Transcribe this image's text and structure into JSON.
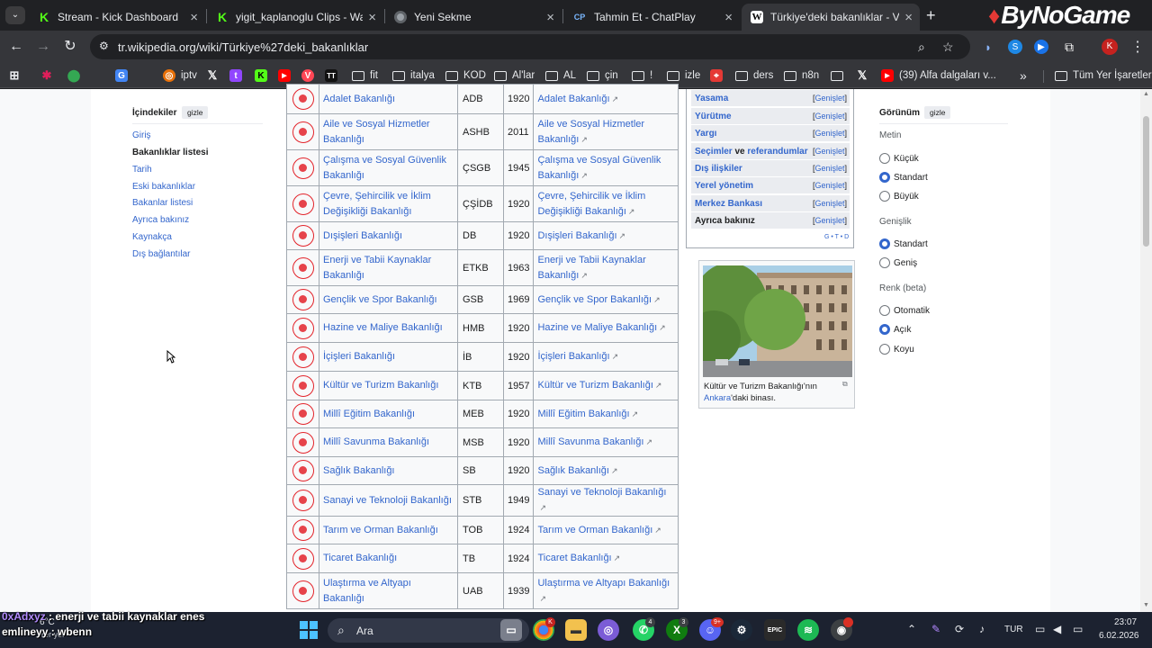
{
  "browser": {
    "tabs": [
      {
        "title": "Stream - Kick Dashboard",
        "favicon": "kick-icon",
        "active": false
      },
      {
        "title": "yigit_kaplanoglu Clips - Watch",
        "favicon": "kick-icon",
        "active": false
      },
      {
        "title": "Yeni Sekme",
        "favicon": "chrome-icon",
        "active": false
      },
      {
        "title": "Tahmin Et - ChatPlay",
        "favicon": "chatplay-icon",
        "active": false
      },
      {
        "title": "Türkiye'deki bakanlıklar - Vikip",
        "favicon": "wikipedia-icon",
        "active": true
      }
    ],
    "url": "tr.wikipedia.org/wiki/Türkiye%27deki_bakanlıklar",
    "profile_initial": "K",
    "brand_overlay": "ByNoGame",
    "bookmarks": [
      {
        "label": "",
        "icon": "apps-grid-icon",
        "type": "icon"
      },
      {
        "label": "",
        "icon": "slack-icon",
        "type": "icon"
      },
      {
        "label": "",
        "icon": "maps-icon",
        "type": "icon"
      },
      {
        "label": "",
        "icon": "translate-icon",
        "type": "icon"
      },
      {
        "label": "iptv",
        "icon": "iptv-icon",
        "type": "link"
      },
      {
        "label": "",
        "icon": "x-icon",
        "type": "icon"
      },
      {
        "label": "",
        "icon": "twitch-icon",
        "type": "icon"
      },
      {
        "label": "",
        "icon": "kick-icon",
        "type": "icon"
      },
      {
        "label": "",
        "icon": "youtube-icon",
        "type": "icon"
      },
      {
        "label": "",
        "icon": "valorant-icon",
        "type": "icon"
      },
      {
        "label": "",
        "icon": "tracker-icon",
        "type": "icon"
      },
      {
        "label": "fit",
        "icon": "folder-icon",
        "type": "folder"
      },
      {
        "label": "italya",
        "icon": "folder-icon",
        "type": "folder"
      },
      {
        "label": "KOD",
        "icon": "folder-icon",
        "type": "folder"
      },
      {
        "label": "Al'lar",
        "icon": "folder-icon",
        "type": "folder"
      },
      {
        "label": "AL",
        "icon": "folder-icon",
        "type": "folder"
      },
      {
        "label": "çin",
        "icon": "folder-icon",
        "type": "folder"
      },
      {
        "label": "!",
        "icon": "folder-icon",
        "type": "folder"
      },
      {
        "label": "izle",
        "icon": "folder-icon",
        "type": "folder"
      },
      {
        "label": "",
        "icon": "pdf-icon",
        "type": "icon"
      },
      {
        "label": "ders",
        "icon": "folder-icon",
        "type": "folder"
      },
      {
        "label": "n8n",
        "icon": "folder-icon",
        "type": "folder"
      },
      {
        "label": "",
        "icon": "folder-icon",
        "type": "folder"
      },
      {
        "label": "",
        "icon": "x-icon",
        "type": "icon"
      },
      {
        "label": "(39) Alfa dalgaları v...",
        "icon": "youtube-icon",
        "type": "link"
      }
    ],
    "bookmarks_more": "»",
    "all_bookmarks": "Tüm Yer İşaretleri"
  },
  "toc": {
    "title": "İçindekiler",
    "hide_label": "gizle",
    "items": [
      "Giriş",
      "Bakanlıklar listesi",
      "Tarih",
      "Eski bakanlıklar",
      "Bakanlar listesi",
      "Ayrıca bakınız",
      "Kaynakça",
      "Dış bağlantılar"
    ],
    "current_index": 1
  },
  "ministries": [
    {
      "name": "Adalet Bakanlığı",
      "abbr": "ADB",
      "year": "1920",
      "site": "Adalet Bakanlığı"
    },
    {
      "name": "Aile ve Sosyal Hizmetler Bakanlığı",
      "abbr": "ASHB",
      "year": "2011",
      "site": "Aile ve Sosyal Hizmetler Bakanlığı"
    },
    {
      "name": "Çalışma ve Sosyal Güvenlik Bakanlığı",
      "abbr": "ÇSGB",
      "year": "1945",
      "site": "Çalışma ve Sosyal Güvenlik Bakanlığı"
    },
    {
      "name": "Çevre, Şehircilik ve İklim Değişikliği Bakanlığı",
      "abbr": "ÇŞİDB",
      "year": "1920",
      "site": "Çevre, Şehircilik ve İklim Değişikliği Bakanlığı"
    },
    {
      "name": "Dışişleri Bakanlığı",
      "abbr": "DB",
      "year": "1920",
      "site": "Dışişleri Bakanlığı"
    },
    {
      "name": "Enerji ve Tabii Kaynaklar Bakanlığı",
      "abbr": "ETKB",
      "year": "1963",
      "site": "Enerji ve Tabii Kaynaklar Bakanlığı"
    },
    {
      "name": "Gençlik ve Spor Bakanlığı",
      "abbr": "GSB",
      "year": "1969",
      "site": "Gençlik ve Spor Bakanlığı"
    },
    {
      "name": "Hazine ve Maliye Bakanlığı",
      "abbr": "HMB",
      "year": "1920",
      "site": "Hazine ve Maliye Bakanlığı"
    },
    {
      "name": "İçişleri Bakanlığı",
      "abbr": "İB",
      "year": "1920",
      "site": "İçişleri Bakanlığı"
    },
    {
      "name": "Kültür ve Turizm Bakanlığı",
      "abbr": "KTB",
      "year": "1957",
      "site": "Kültür ve Turizm Bakanlığı"
    },
    {
      "name": "Millî Eğitim Bakanlığı",
      "abbr": "MEB",
      "year": "1920",
      "site": "Millî Eğitim Bakanlığı"
    },
    {
      "name": "Millî Savunma Bakanlığı",
      "abbr": "MSB",
      "year": "1920",
      "site": "Millî Savunma Bakanlığı"
    },
    {
      "name": "Sağlık Bakanlığı",
      "abbr": "SB",
      "year": "1920",
      "site": "Sağlık Bakanlığı"
    },
    {
      "name": "Sanayi ve Teknoloji Bakanlığı",
      "abbr": "STB",
      "year": "1949",
      "site": "Sanayi ve Teknoloji Bakanlığı"
    },
    {
      "name": "Tarım ve Orman Bakanlığı",
      "abbr": "TOB",
      "year": "1924",
      "site": "Tarım ve Orman Bakanlığı"
    },
    {
      "name": "Ticaret Bakanlığı",
      "abbr": "TB",
      "year": "1924",
      "site": "Ticaret Bakanlığı"
    },
    {
      "name": "Ulaştırma ve Altyapı Bakanlığı",
      "abbr": "UAB",
      "year": "1939",
      "site": "Ulaştırma ve Altyapı Bakanlığı"
    }
  ],
  "navbox": {
    "expand_label": "Genişlet",
    "rows": [
      {
        "label": "Yasama"
      },
      {
        "label": "Yürütme"
      },
      {
        "label": "Yargı"
      },
      {
        "label_a": "Seçimler",
        "label_mid": "ve",
        "label_b": "referandumlar"
      },
      {
        "label": "Dış ilişkiler"
      },
      {
        "label": "Yerel yönetim"
      },
      {
        "label": "Merkez Bankası"
      },
      {
        "label": "Ayrıca bakınız"
      }
    ],
    "vte": "G • T • D"
  },
  "image": {
    "caption_pre": "Kültür ve Turizm Bakanlığı'nın ",
    "caption_link": "Ankara",
    "caption_post": "'daki binası."
  },
  "appearance": {
    "title": "Görünüm",
    "hide_label": "gizle",
    "text_group": "Metin",
    "text_options": [
      "Küçük",
      "Standart",
      "Büyük"
    ],
    "text_selected": 1,
    "width_group": "Genişlik",
    "width_options": [
      "Standart",
      "Geniş"
    ],
    "width_selected": 0,
    "color_group": "Renk (beta)",
    "color_options": [
      "Otomatik",
      "Açık",
      "Koyu"
    ],
    "color_selected": 1
  },
  "chat_overlay": {
    "line1_user": "0xAdxyz",
    "line1_msg": ": enerji ve tabii kaynaklar enes",
    "line2_user": "emlineyy",
    "line2_msg": ": wbenn"
  },
  "taskbar": {
    "weather_temp": "6°C",
    "weather_desc": "Yer yer",
    "search_placeholder": "Ara",
    "language": "TUR",
    "time": "23:07",
    "date": "6.02.2026",
    "badges": {
      "chrome": "K",
      "whatsapp": "4",
      "xbox": "3",
      "discord": "9+"
    }
  }
}
